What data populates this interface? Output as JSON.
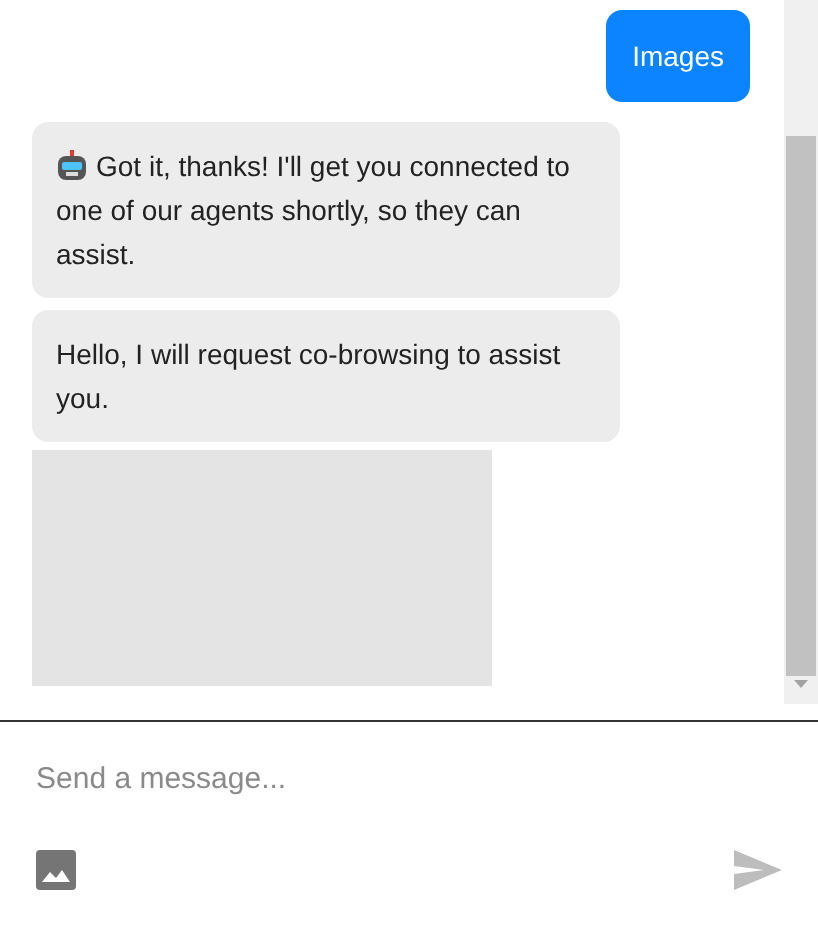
{
  "messages": [
    {
      "kind": "user",
      "text": "Images"
    },
    {
      "kind": "bot",
      "icon": true,
      "text": "Got it, thanks! I'll get you connected to one of our agents shortly, so they can assist."
    },
    {
      "kind": "bot",
      "icon": false,
      "text": "Hello, I will request co-browsing to assist you."
    },
    {
      "kind": "attachment"
    }
  ],
  "composer": {
    "placeholder": "Send a message..."
  }
}
